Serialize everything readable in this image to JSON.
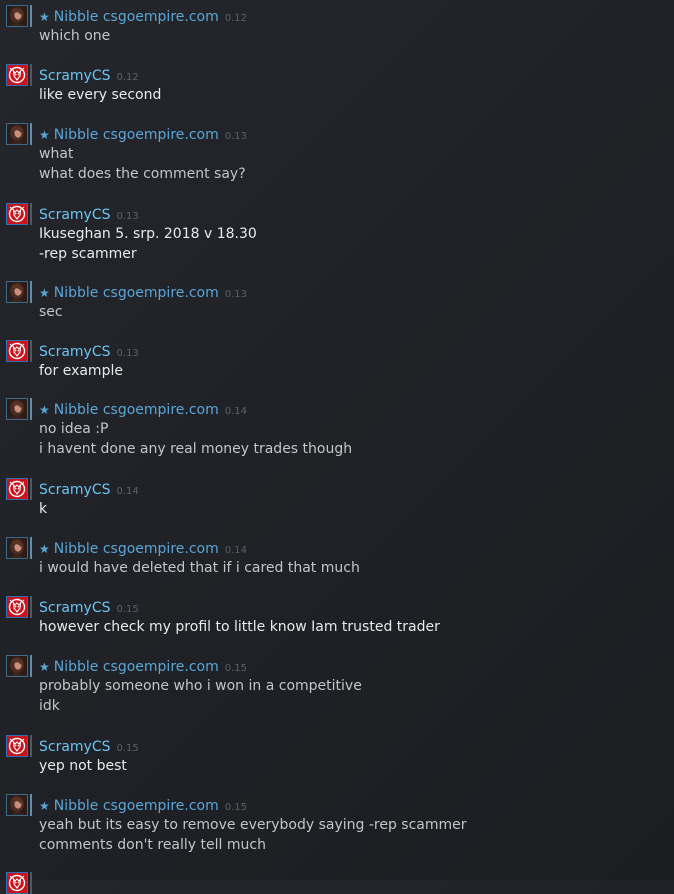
{
  "chat": {
    "messages": [
      {
        "sender": "friend",
        "star": "★",
        "name": "Nibble csgoempire.com",
        "time": "0.12",
        "lines": [
          "which one"
        ]
      },
      {
        "sender": "self",
        "star": "",
        "name": "ScramyCS",
        "time": "0.12",
        "lines": [
          "like every second"
        ]
      },
      {
        "sender": "friend",
        "star": "★",
        "name": "Nibble csgoempire.com",
        "time": "0.13",
        "lines": [
          "what",
          "what does the comment say?"
        ]
      },
      {
        "sender": "self",
        "star": "",
        "name": "ScramyCS",
        "time": "0.13",
        "lines": [
          "Ikuseghan 5. srp. 2018 v 18.30",
          "-rep scammer"
        ]
      },
      {
        "sender": "friend",
        "star": "★",
        "name": "Nibble csgoempire.com",
        "time": "0.13",
        "lines": [
          "sec"
        ]
      },
      {
        "sender": "self",
        "star": "",
        "name": "ScramyCS",
        "time": "0.13",
        "lines": [
          "for example"
        ]
      },
      {
        "sender": "friend",
        "star": "★",
        "name": "Nibble csgoempire.com",
        "time": "0.14",
        "lines": [
          "no idea :P",
          "i havent done any real money trades though"
        ]
      },
      {
        "sender": "self",
        "star": "",
        "name": "ScramyCS",
        "time": "0.14",
        "lines": [
          "k"
        ]
      },
      {
        "sender": "friend",
        "star": "★",
        "name": "Nibble csgoempire.com",
        "time": "0.14",
        "lines": [
          "i would have deleted that if i cared that much"
        ]
      },
      {
        "sender": "self",
        "star": "",
        "name": "ScramyCS",
        "time": "0.15",
        "lines": [
          "however check my profil to little know Iam trusted trader"
        ]
      },
      {
        "sender": "friend",
        "star": "★",
        "name": "Nibble csgoempire.com",
        "time": "0.15",
        "lines": [
          "probably someone who i won in a competitive",
          "idk"
        ]
      },
      {
        "sender": "self",
        "star": "",
        "name": "ScramyCS",
        "time": "0.15",
        "lines": [
          "yep not best"
        ]
      },
      {
        "sender": "friend",
        "star": "★",
        "name": "Nibble csgoempire.com",
        "time": "0.15",
        "lines": [
          "yeah but its easy to remove everybody saying -rep scammer",
          "comments don't really tell much"
        ]
      },
      {
        "sender": "self",
        "star": "",
        "name": "",
        "time": "",
        "lines": []
      }
    ]
  },
  "colors": {
    "friend_name": "#5aa6d6",
    "self_name": "#6cc4f2",
    "friend_text": "#c3c5c8",
    "self_text": "#e8eaec",
    "timestamp": "#5c6068",
    "self_avatar_bg": "#c8121c"
  },
  "icons": {
    "friend_avatar": "woman-portrait-avatar-icon",
    "self_avatar": "red-lion-emblem-avatar-icon",
    "favorite": "star-icon"
  }
}
